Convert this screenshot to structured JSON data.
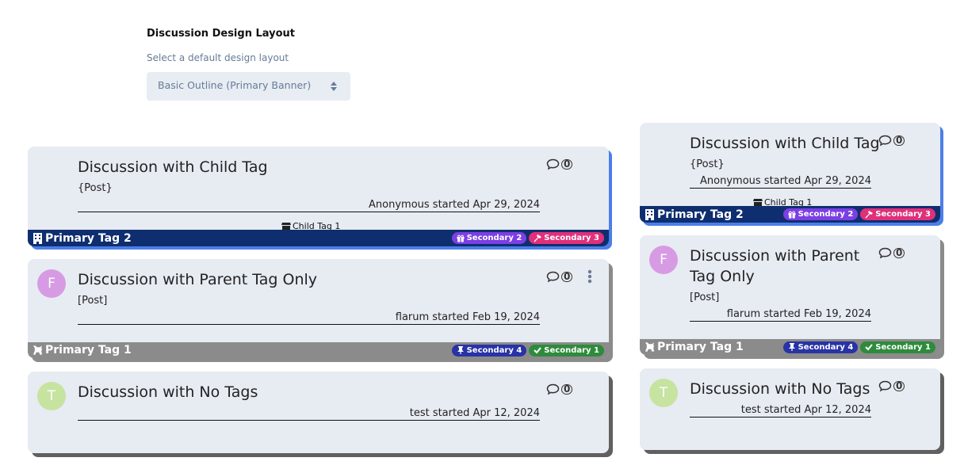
{
  "setting": {
    "title": "Discussion Design Layout",
    "help": "Select a default design layout",
    "select_value": "Basic Outline (Primary Banner)"
  },
  "colors": {
    "card_bg": "#e7ebf2",
    "child_banner": "#0f2e6f",
    "parent_banner": "#8b8b8b",
    "shadow_blue": "#4c7ee8",
    "secondary_2": "#7b3fe4",
    "secondary_3": "#e0307a",
    "secondary_4": "#2833a6",
    "secondary_1": "#2e8b3c"
  },
  "discussions": [
    {
      "title": "Discussion with Child Tag",
      "subtitle": "{Post}",
      "meta": "Anonymous started Apr 29, 2024",
      "replies": "0",
      "child_tag": "Child Tag 1",
      "primary_tag": "Primary Tag 2",
      "primary_icon": "building-icon",
      "secondary": [
        {
          "label": "Secondary 2",
          "icon": "gift-icon",
          "color": "#7b3fe4"
        },
        {
          "label": "Secondary 3",
          "icon": "hammer-icon",
          "color": "#e0307a"
        }
      ]
    },
    {
      "title": "Discussion with Parent Tag Only",
      "title_line1": "Discussion with Parent",
      "title_line2": "Tag Only",
      "subtitle": "[Post]",
      "meta": "flarum started Feb 19, 2024",
      "replies": "0",
      "avatar": "F",
      "avatar_color": "#d79be3",
      "primary_tag": "Primary Tag 1",
      "primary_icon": "cat-icon",
      "secondary": [
        {
          "label": "Secondary 4",
          "icon": "thumbtack-icon",
          "color": "#2833a6"
        },
        {
          "label": "Secondary 1",
          "icon": "check-icon",
          "color": "#2e8b3c"
        }
      ]
    },
    {
      "title": "Discussion with No Tags",
      "meta": "test started Apr 12, 2024",
      "replies": "0",
      "avatar": "T",
      "avatar_color": "#c6e3a0"
    }
  ]
}
